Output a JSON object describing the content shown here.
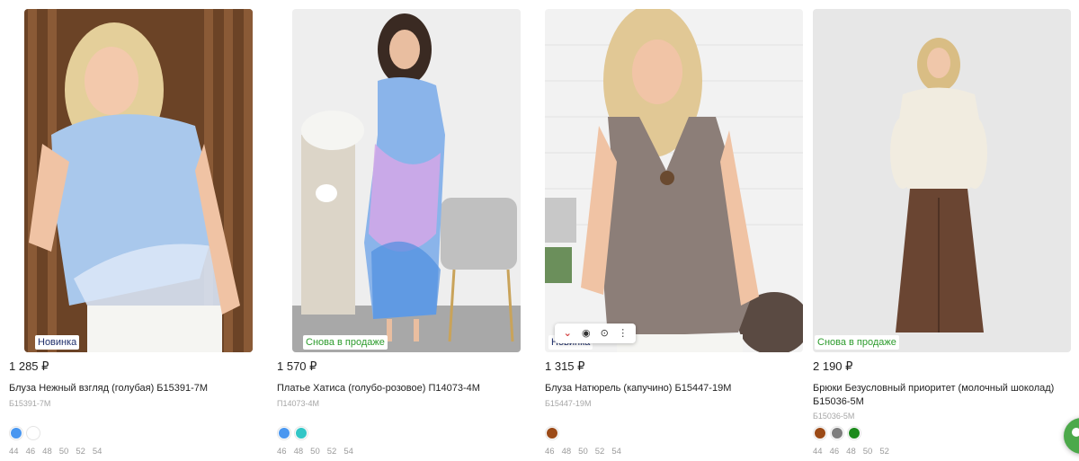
{
  "products": [
    {
      "badge": "Новинка",
      "badge_type": "new",
      "price": "1 285 ₽",
      "name": "Блуза Нежный взгляд (голубая) Б15391-7М",
      "sku": "Б15391-7М",
      "swatches": [
        "#4a97f0",
        "#ffffff"
      ],
      "sizes": [
        "44",
        "46",
        "48",
        "50",
        "52",
        "54"
      ],
      "image": "photo-blue-blouse"
    },
    {
      "badge": "Снова в продаже",
      "badge_type": "sale",
      "price": "1 570 ₽",
      "name": "Платье Хатиса (голубо-розовое) П14073-4М",
      "sku": "П14073-4М",
      "swatches": [
        "#4a97f0",
        "#32c6c6"
      ],
      "sizes": [
        "46",
        "48",
        "50",
        "52",
        "54"
      ],
      "image": "photo-floral-dress"
    },
    {
      "badge": "Новинка",
      "badge_type": "new",
      "price": "1 315 ₽",
      "name": "Блуза Натюрель (капучино) Б15447-19М",
      "sku": "Б15447-19М",
      "swatches": [
        "#9b4a17"
      ],
      "sizes": [
        "46",
        "48",
        "50",
        "52",
        "54"
      ],
      "image": "photo-linen-top"
    },
    {
      "badge": "Снова в продаже",
      "badge_type": "sale",
      "price": "2 190 ₽",
      "name": "Брюки Безусловный приоритет (молочный шоколад) Б15036-5М",
      "sku": "Б15036-5М",
      "swatches": [
        "#9b4a17",
        "#7d7d7d",
        "#1c8a1c"
      ],
      "sizes": [
        "44",
        "46",
        "48",
        "50",
        "52"
      ],
      "image": "photo-brown-trousers"
    }
  ],
  "image_toolbar": {
    "icons": [
      "close-x-icon",
      "eye-icon",
      "camera-icon",
      "more-vertical-icon"
    ]
  },
  "colors": {
    "badge_new": "#1f2f6b",
    "badge_sale": "#2c9b2c",
    "fab": "#4ca94a"
  }
}
